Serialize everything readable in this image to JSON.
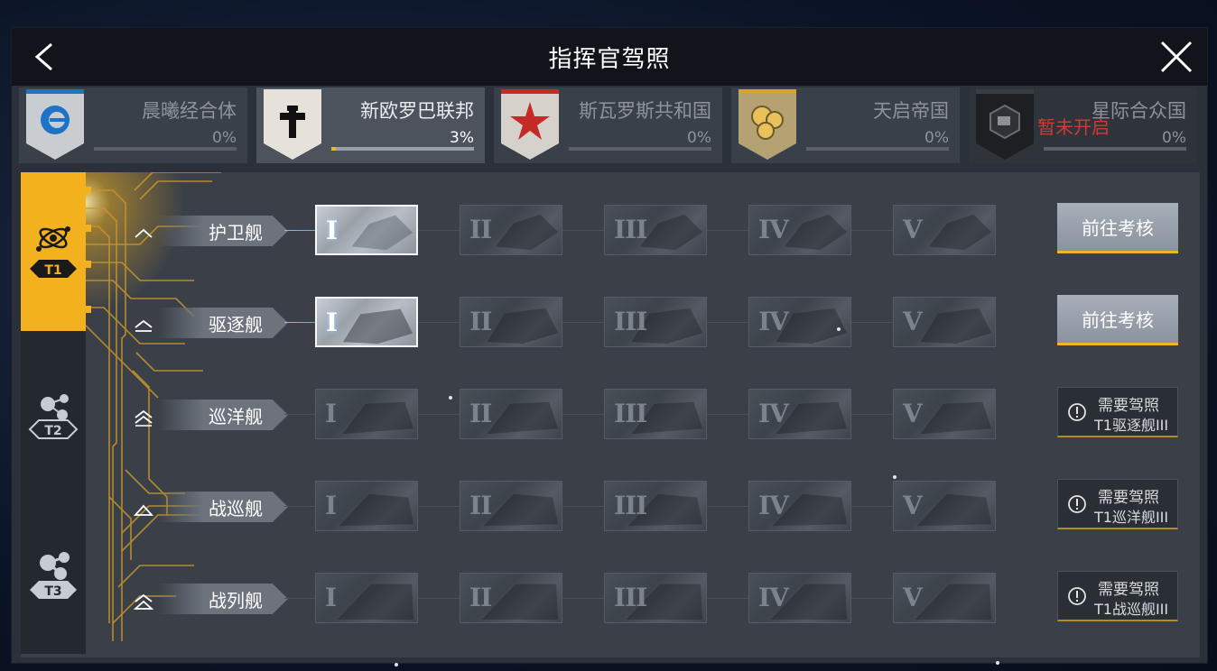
{
  "header": {
    "title": "指挥官驾照"
  },
  "factions": [
    {
      "name": "晨曦经合体",
      "progress_text": "0%",
      "progress": 0,
      "state": "normal",
      "emblem_color": "#1e73c6"
    },
    {
      "name": "新欧罗巴联邦",
      "progress_text": "3%",
      "progress": 0.03,
      "state": "active",
      "emblem_color": "#1a1a1a"
    },
    {
      "name": "斯瓦罗斯共和国",
      "progress_text": "0%",
      "progress": 0,
      "state": "normal",
      "emblem_color": "#c42a26"
    },
    {
      "name": "天启帝国",
      "progress_text": "0%",
      "progress": 0,
      "state": "normal",
      "emblem_color": "#d4a52c"
    },
    {
      "name": "星际合众国",
      "progress_text": "0%",
      "progress": 0,
      "state": "locked",
      "emblem_color": "#1a1a1a",
      "lock_text": "暂未开启"
    }
  ],
  "tiers": [
    {
      "label": "T1",
      "active": true
    },
    {
      "label": "T2",
      "active": false
    },
    {
      "label": "T3",
      "active": false
    }
  ],
  "ship_classes": [
    {
      "name": "护卫舰",
      "ranks": [
        "I",
        "II",
        "III",
        "IV",
        "V"
      ],
      "unlocked_ranks": 1,
      "action": {
        "type": "button",
        "label": "前往考核"
      }
    },
    {
      "name": "驱逐舰",
      "ranks": [
        "I",
        "II",
        "III",
        "IV",
        "V"
      ],
      "unlocked_ranks": 1,
      "action": {
        "type": "button",
        "label": "前往考核"
      }
    },
    {
      "name": "巡洋舰",
      "ranks": [
        "I",
        "II",
        "III",
        "IV",
        "V"
      ],
      "unlocked_ranks": 0,
      "action": {
        "type": "requirement",
        "line1": "需要驾照",
        "line2": "T1驱逐舰III"
      }
    },
    {
      "name": "战巡舰",
      "ranks": [
        "I",
        "II",
        "III",
        "IV",
        "V"
      ],
      "unlocked_ranks": 0,
      "action": {
        "type": "requirement",
        "line1": "需要驾照",
        "line2": "T1巡洋舰III"
      }
    },
    {
      "name": "战列舰",
      "ranks": [
        "I",
        "II",
        "III",
        "IV",
        "V"
      ],
      "unlocked_ranks": 0,
      "action": {
        "type": "requirement",
        "line1": "需要驾照",
        "line2": "T1战巡舰III"
      }
    }
  ],
  "colors": {
    "accent": "#f3b21d",
    "locked_text": "#d03a32"
  }
}
